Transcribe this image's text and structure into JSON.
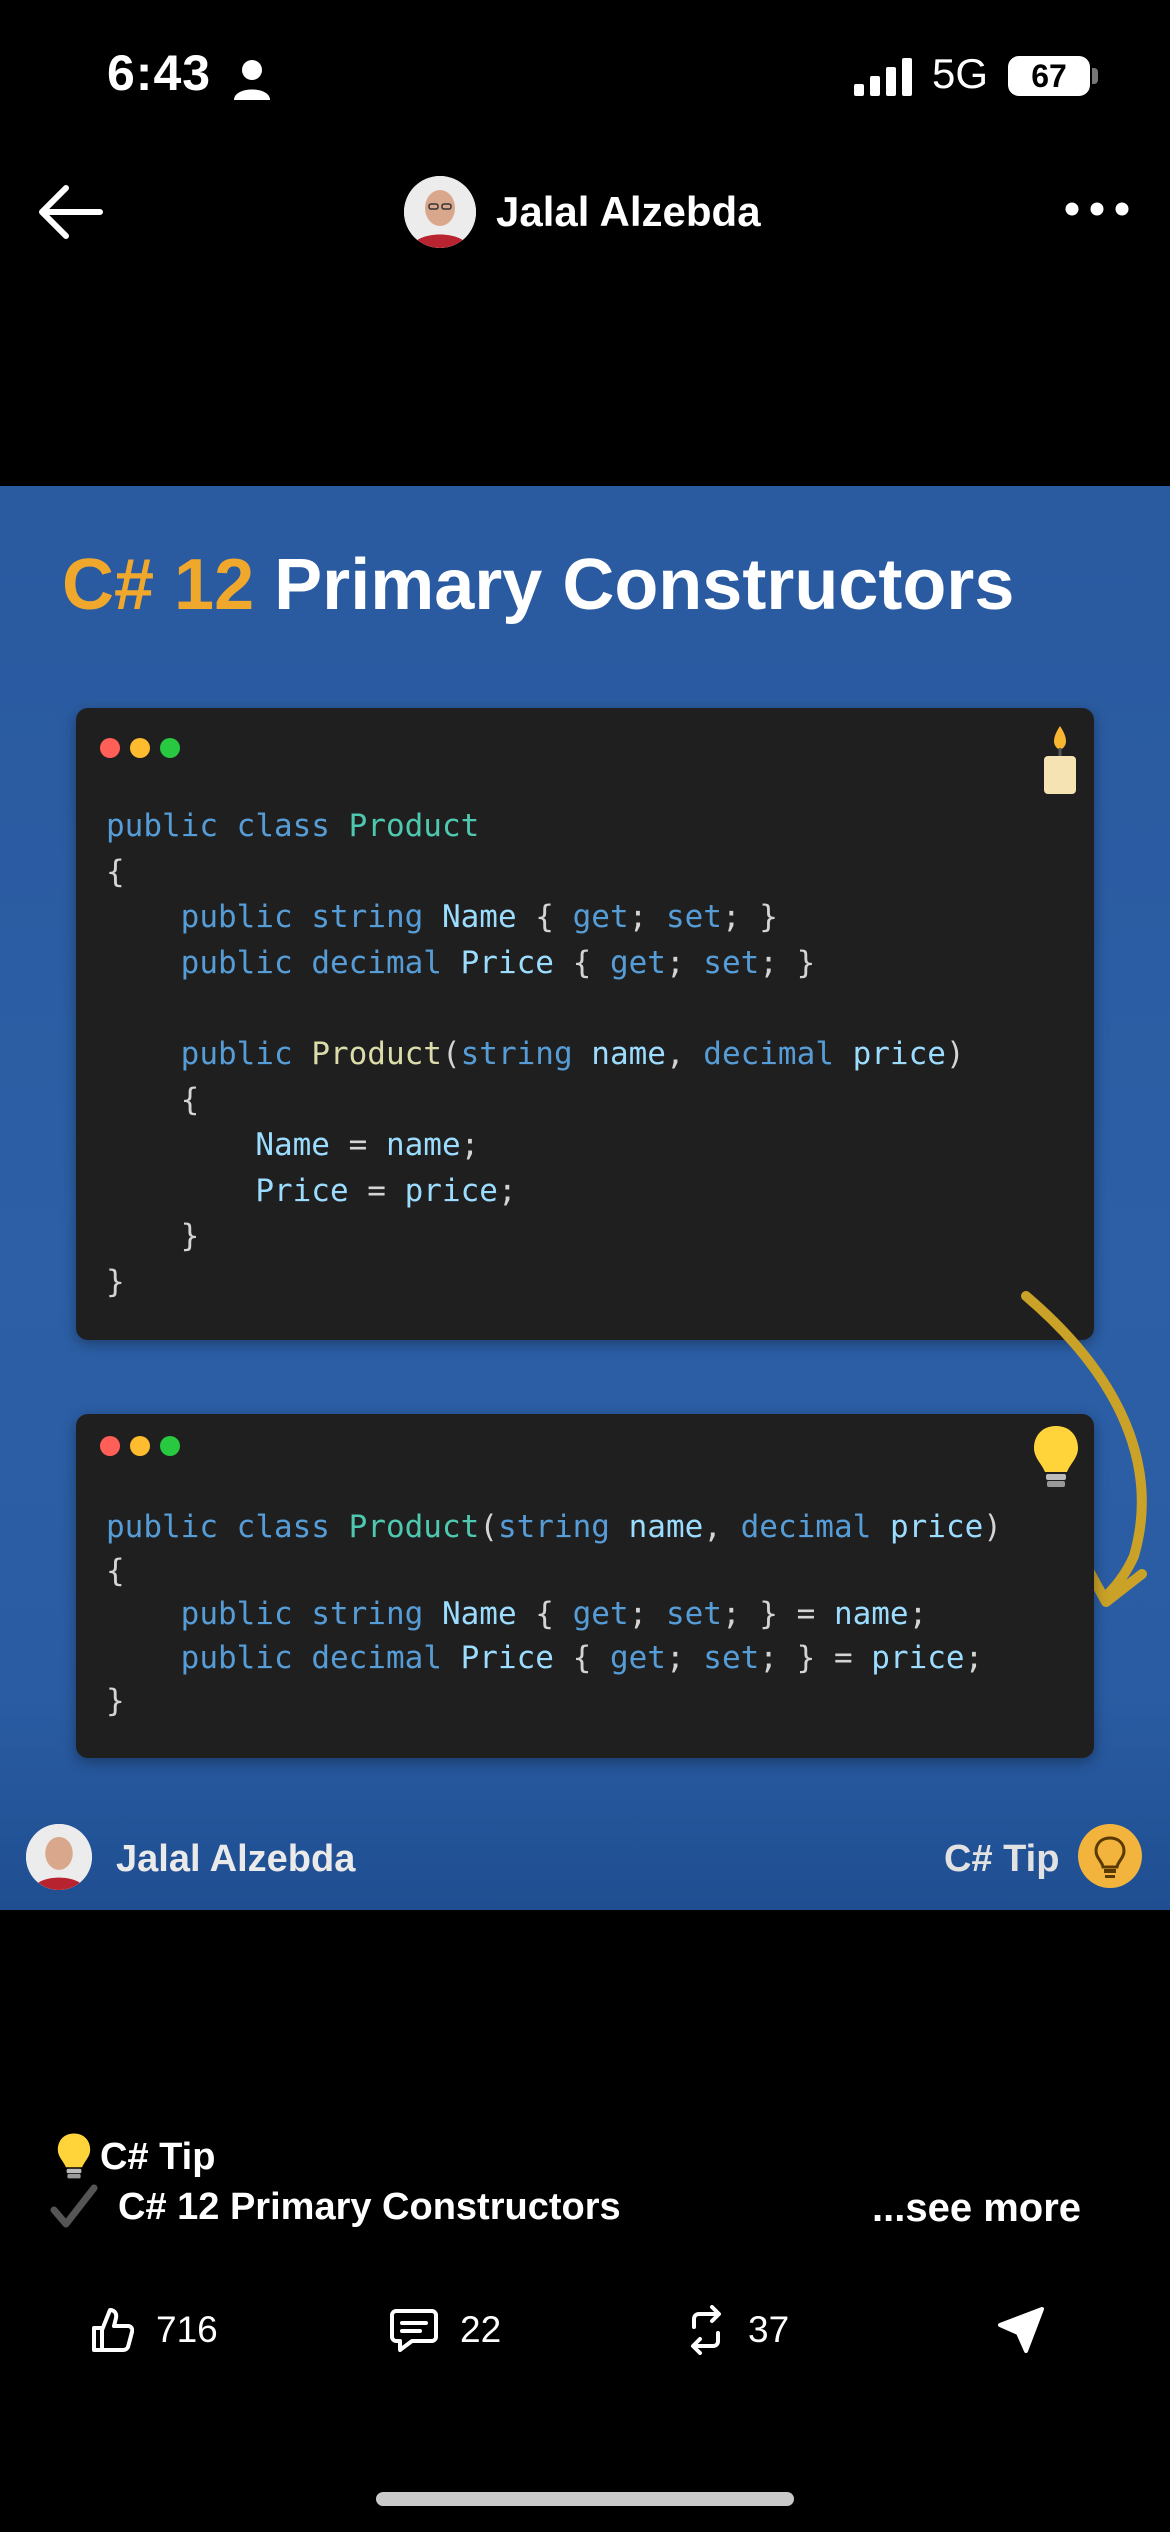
{
  "status_bar": {
    "time": "6:43",
    "network": "5G",
    "battery": "67"
  },
  "header": {
    "author_name": "Jalal Alzebda"
  },
  "post_image": {
    "title_highlight": "C# 12",
    "title_rest": "Primary Constructors",
    "code_before": [
      [
        [
          "kw",
          "public"
        ],
        [
          "p",
          " "
        ],
        [
          "kw",
          "class"
        ],
        [
          "p",
          " "
        ],
        [
          "ty",
          "Product"
        ]
      ],
      [
        [
          "p",
          "{"
        ]
      ],
      [
        [
          "p",
          "    "
        ],
        [
          "kw",
          "public"
        ],
        [
          "p",
          " "
        ],
        [
          "kw",
          "string"
        ],
        [
          "p",
          " "
        ],
        [
          "id",
          "Name"
        ],
        [
          "p",
          " { "
        ],
        [
          "kw",
          "get"
        ],
        [
          "p",
          "; "
        ],
        [
          "kw",
          "set"
        ],
        [
          "p",
          "; }"
        ]
      ],
      [
        [
          "p",
          "    "
        ],
        [
          "kw",
          "public"
        ],
        [
          "p",
          " "
        ],
        [
          "kw",
          "decimal"
        ],
        [
          "p",
          " "
        ],
        [
          "id",
          "Price"
        ],
        [
          "p",
          " { "
        ],
        [
          "kw",
          "get"
        ],
        [
          "p",
          "; "
        ],
        [
          "kw",
          "set"
        ],
        [
          "p",
          "; }"
        ]
      ],
      [
        [
          "p",
          ""
        ]
      ],
      [
        [
          "p",
          "    "
        ],
        [
          "kw",
          "public"
        ],
        [
          "p",
          " "
        ],
        [
          "fn",
          "Product"
        ],
        [
          "p",
          "("
        ],
        [
          "kw",
          "string"
        ],
        [
          "p",
          " "
        ],
        [
          "id",
          "name"
        ],
        [
          "p",
          ", "
        ],
        [
          "kw",
          "decimal"
        ],
        [
          "p",
          " "
        ],
        [
          "id",
          "price"
        ],
        [
          "p",
          ")"
        ]
      ],
      [
        [
          "p",
          "    {"
        ]
      ],
      [
        [
          "p",
          "        "
        ],
        [
          "id",
          "Name"
        ],
        [
          "p",
          " = "
        ],
        [
          "id",
          "name"
        ],
        [
          "p",
          ";"
        ]
      ],
      [
        [
          "p",
          "        "
        ],
        [
          "id",
          "Price"
        ],
        [
          "p",
          " = "
        ],
        [
          "id",
          "price"
        ],
        [
          "p",
          ";"
        ]
      ],
      [
        [
          "p",
          "    }"
        ]
      ],
      [
        [
          "p",
          "}"
        ]
      ]
    ],
    "code_after": [
      [
        [
          "kw",
          "public"
        ],
        [
          "p",
          " "
        ],
        [
          "kw",
          "class"
        ],
        [
          "p",
          " "
        ],
        [
          "ty",
          "Product"
        ],
        [
          "p",
          "("
        ],
        [
          "kw",
          "string"
        ],
        [
          "p",
          " "
        ],
        [
          "id",
          "name"
        ],
        [
          "p",
          ", "
        ],
        [
          "kw",
          "decimal"
        ],
        [
          "p",
          " "
        ],
        [
          "id",
          "price"
        ],
        [
          "p",
          ")"
        ]
      ],
      [
        [
          "p",
          "{"
        ]
      ],
      [
        [
          "p",
          "    "
        ],
        [
          "kw",
          "public"
        ],
        [
          "p",
          " "
        ],
        [
          "kw",
          "string"
        ],
        [
          "p",
          " "
        ],
        [
          "id",
          "Name"
        ],
        [
          "p",
          " { "
        ],
        [
          "kw",
          "get"
        ],
        [
          "p",
          "; "
        ],
        [
          "kw",
          "set"
        ],
        [
          "p",
          "; } = "
        ],
        [
          "id",
          "name"
        ],
        [
          "p",
          ";"
        ]
      ],
      [
        [
          "p",
          "    "
        ],
        [
          "kw",
          "public"
        ],
        [
          "p",
          " "
        ],
        [
          "kw",
          "decimal"
        ],
        [
          "p",
          " "
        ],
        [
          "id",
          "Price"
        ],
        [
          "p",
          " { "
        ],
        [
          "kw",
          "get"
        ],
        [
          "p",
          "; "
        ],
        [
          "kw",
          "set"
        ],
        [
          "p",
          "; } = "
        ],
        [
          "id",
          "price"
        ],
        [
          "p",
          ";"
        ]
      ],
      [
        [
          "p",
          "}"
        ]
      ]
    ],
    "footer_author": "Jalal Alzebda",
    "footer_tag": "C# Tip",
    "icons": [
      "candle-icon",
      "lightbulb-icon",
      "curved-arrow-icon"
    ],
    "colors": {
      "background": "#2a5aa0",
      "title_accent": "#f0a82c",
      "code_bg": "#1f1f1f",
      "arrow": "#c9a227"
    }
  },
  "caption": {
    "line1": "C# Tip",
    "line2": "C# 12 Primary Constructors",
    "see_more": "...see more"
  },
  "actions": {
    "likes": "716",
    "comments": "22",
    "reposts": "37"
  }
}
